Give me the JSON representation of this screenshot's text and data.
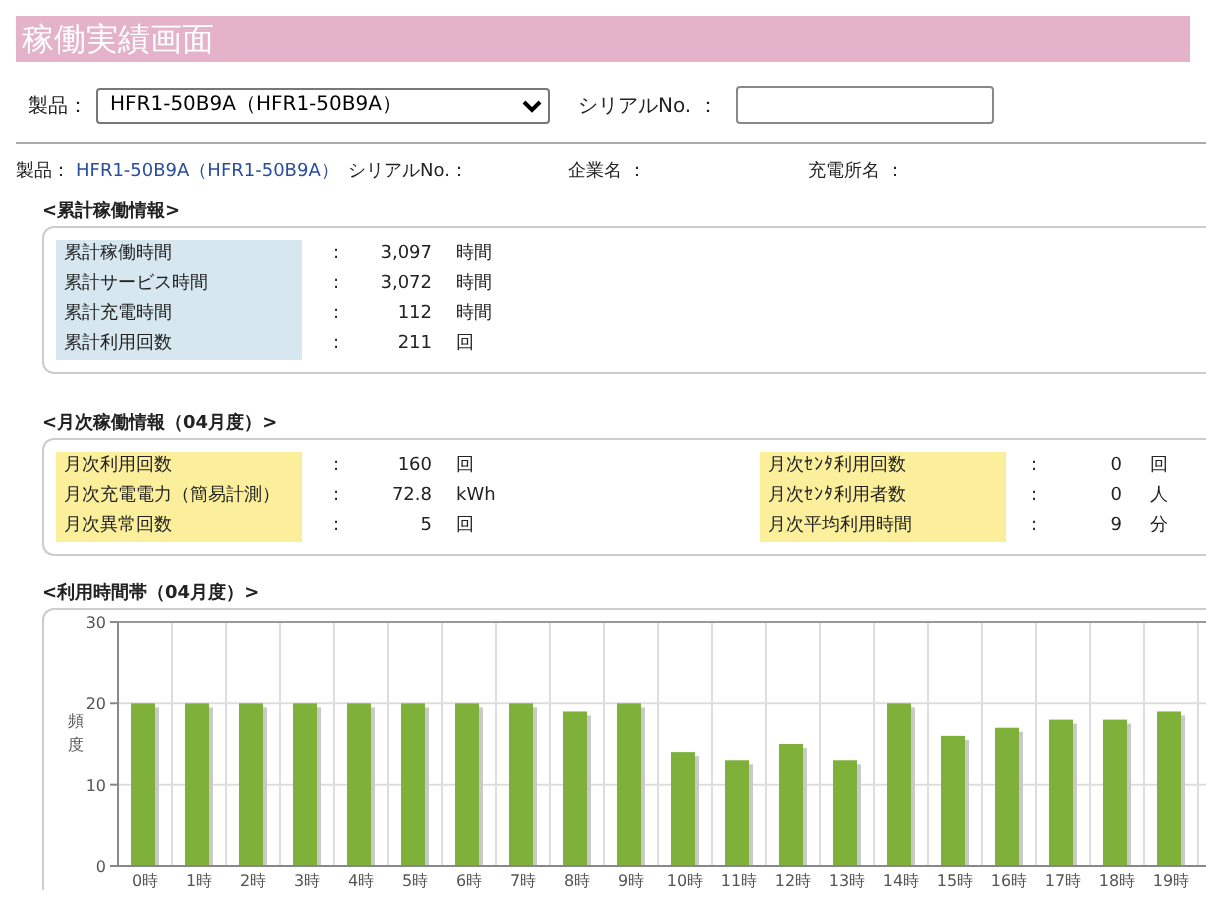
{
  "title": "稼働実績画面",
  "filter": {
    "product_label": "製品：",
    "product_value": "HFR1-50B9A（HFR1-50B9A）",
    "serial_label": "シリアルNo. ："
  },
  "info": [
    {
      "label": "製品：",
      "value": "HFR1-50B9A（HFR1-50B9A）"
    },
    {
      "label": "シリアルNo.："
    },
    {
      "label": "企業名 ："
    },
    {
      "label": "充電所名 ："
    }
  ],
  "cumulative": {
    "title": "<累計稼働情報>",
    "rows": [
      {
        "label": "累計稼働時間",
        "sep": ":",
        "value": "3,097",
        "unit": "時間"
      },
      {
        "label": "累計サービス時間",
        "sep": ":",
        "value": "3,072",
        "unit": "時間"
      },
      {
        "label": "累計充電時間",
        "sep": ":",
        "value": "112",
        "unit": "時間"
      },
      {
        "label": "累計利用回数",
        "sep": ":",
        "value": "211",
        "unit": "回"
      }
    ]
  },
  "monthly": {
    "title": "<月次稼働情報（04月度）>",
    "left": [
      {
        "label": "月次利用回数",
        "sep": ":",
        "value": "160",
        "unit": "回"
      },
      {
        "label": "月次充電電力（簡易計測）",
        "sep": ":",
        "value": "72.8",
        "unit": "kWh"
      },
      {
        "label": "月次異常回数",
        "sep": ":",
        "value": "5",
        "unit": "回"
      }
    ],
    "right": [
      {
        "label": "月次ｾﾝﾀ利用回数",
        "sep": ":",
        "value": "0",
        "unit": "回"
      },
      {
        "label": "月次ｾﾝﾀ利用者数",
        "sep": ":",
        "value": "0",
        "unit": "人"
      },
      {
        "label": "月次平均利用時間",
        "sep": ":",
        "value": "9",
        "unit": "分"
      }
    ]
  },
  "usage": {
    "title": "<利用時間帯（04月度）>",
    "chart_data": {
      "type": "bar",
      "ylabel": "頻度",
      "categories": [
        "0時",
        "1時",
        "2時",
        "3時",
        "4時",
        "5時",
        "6時",
        "7時",
        "8時",
        "9時",
        "10時",
        "11時",
        "12時",
        "13時",
        "14時",
        "15時",
        "16時",
        "17時",
        "18時",
        "19時"
      ],
      "values": [
        20,
        20,
        20,
        20,
        20,
        20,
        20,
        20,
        19,
        20,
        14,
        13,
        15,
        13,
        20,
        16,
        17,
        18,
        18,
        19
      ],
      "ylim": [
        0,
        30
      ],
      "yticks": [
        0,
        10,
        20,
        30
      ]
    }
  }
}
